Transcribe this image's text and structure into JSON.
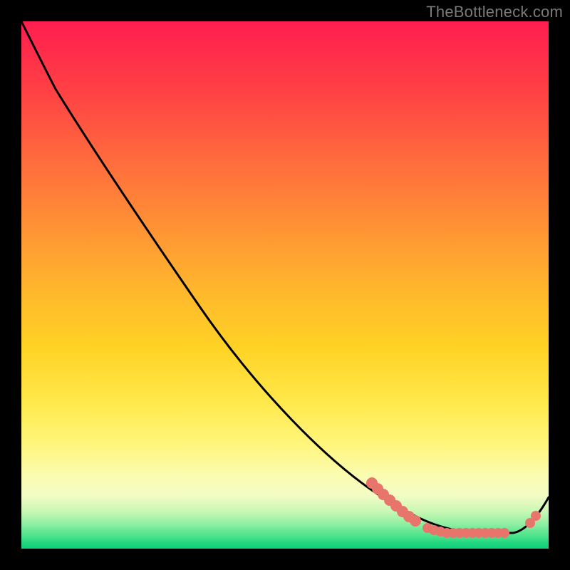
{
  "attribution": "TheBottleneck.com",
  "colors": {
    "curve": "#000000",
    "dots": "#e8756b",
    "gradient_top": "#ff1e4f",
    "gradient_mid": "#ffd325",
    "gradient_bottom": "#0fd07a",
    "frame": "#000000",
    "attribution_text": "#7a7a7a"
  },
  "chart_data": {
    "type": "line",
    "title": "",
    "xlabel": "",
    "ylabel": "",
    "xlim": [
      0,
      100
    ],
    "ylim": [
      0,
      100
    ],
    "grid": false,
    "legend": false,
    "note": "Axes are unlabeled; x and y are normalized 0–100 from the plot frame. y is the curve height (100 = top of colored area, 0 = bottom). Background color encodes y: red≈high, green≈low.",
    "series": [
      {
        "name": "curve",
        "x": [
          0,
          3,
          6,
          10,
          15,
          20,
          25,
          30,
          35,
          40,
          45,
          50,
          55,
          60,
          65,
          70,
          75,
          80,
          85,
          88,
          92,
          96,
          100
        ],
        "y": [
          100,
          95,
          90,
          85,
          79,
          73,
          66,
          59,
          52,
          46,
          39,
          33,
          27,
          21,
          16,
          11,
          7,
          4,
          3,
          3,
          3,
          5,
          10
        ],
        "color": "#000000"
      }
    ],
    "highlight_points": {
      "name": "dots",
      "color": "#e8756b",
      "x": [
        66,
        67,
        69,
        70,
        71,
        72,
        73,
        75,
        77,
        78,
        79,
        81,
        82,
        83,
        84,
        86,
        87,
        88,
        89,
        90,
        92,
        97,
        98
      ],
      "y": [
        12,
        11,
        10,
        9,
        8,
        7,
        6,
        5,
        4,
        3,
        3,
        3,
        3,
        3,
        3,
        3,
        3,
        3,
        3,
        3,
        3,
        5,
        6
      ]
    }
  }
}
